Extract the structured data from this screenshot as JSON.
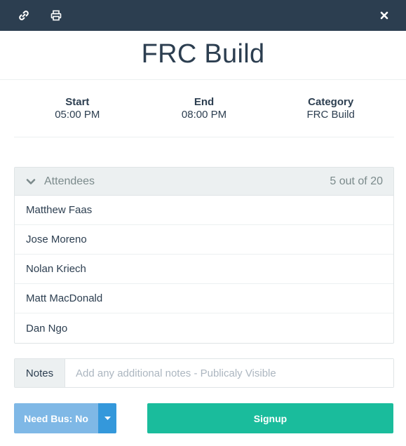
{
  "toolbar": {
    "icons": [
      "link-icon",
      "print-icon",
      "close-icon"
    ],
    "background": "#2c3e50"
  },
  "event": {
    "title": "FRC Build",
    "start_label": "Start",
    "start_value": "05:00 PM",
    "end_label": "End",
    "end_value": "08:00 PM",
    "category_label": "Category",
    "category_value": "FRC Build"
  },
  "attendees": {
    "header": "Attendees",
    "count": "5 out of 20",
    "items": [
      {
        "name": "Matthew Faas"
      },
      {
        "name": "Jose Moreno"
      },
      {
        "name": "Nolan Kriech"
      },
      {
        "name": "Matt MacDonald"
      },
      {
        "name": "Dan Ngo"
      }
    ]
  },
  "notes": {
    "label": "Notes",
    "placeholder": "Add any additional notes - Publicaly Visible",
    "value": ""
  },
  "actions": {
    "bus_label": "Need Bus: No",
    "signup_label": "Signup"
  },
  "colors": {
    "primary_dark": "#2c3e50",
    "bus_button": "#7fb8e6",
    "bus_caret": "#3498db",
    "signup_button": "#1abc9c"
  }
}
